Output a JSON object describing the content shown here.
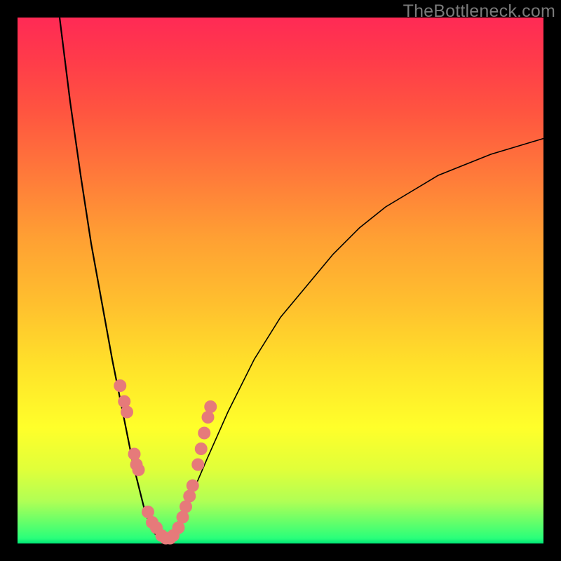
{
  "watermark": "TheBottleneck.com",
  "colors": {
    "dot": "#e67a7a",
    "curve": "#000000"
  },
  "chart_data": {
    "type": "line",
    "title": "",
    "xlabel": "",
    "ylabel": "",
    "xlim": [
      0,
      100
    ],
    "ylim": [
      0,
      100
    ],
    "grid": false,
    "legend": false,
    "series": [
      {
        "name": "left-curve",
        "x": [
          8,
          10,
          12,
          14,
          16,
          18,
          19,
          20,
          21,
          22,
          23,
          24,
          25,
          26,
          27,
          28
        ],
        "y": [
          100,
          84,
          70,
          57,
          46,
          35,
          30,
          25,
          20,
          15,
          11,
          7,
          4,
          2,
          1,
          0
        ]
      },
      {
        "name": "right-curve",
        "x": [
          28,
          30,
          33,
          36,
          40,
          45,
          50,
          55,
          60,
          65,
          70,
          75,
          80,
          85,
          90,
          95,
          100
        ],
        "y": [
          0,
          3,
          9,
          16,
          25,
          35,
          43,
          49,
          55,
          60,
          64,
          67,
          70,
          72,
          74,
          75.5,
          77
        ]
      },
      {
        "name": "dots",
        "x": [
          19.5,
          20.3,
          20.8,
          22.2,
          22.6,
          23.0,
          24.8,
          25.6,
          26.4,
          27.4,
          28.2,
          29.0,
          29.6,
          30.6,
          31.4,
          32.0,
          32.7,
          33.3,
          34.3,
          34.9,
          35.5,
          36.2,
          36.7
        ],
        "y": [
          30,
          27,
          25,
          17,
          15,
          14,
          6,
          4,
          3,
          1.5,
          1,
          1,
          1.5,
          3,
          5,
          7,
          9,
          11,
          15,
          18,
          21,
          24,
          26
        ]
      }
    ],
    "background_gradient": [
      "#ff2a55",
      "#ffff2a",
      "#00e676"
    ]
  }
}
